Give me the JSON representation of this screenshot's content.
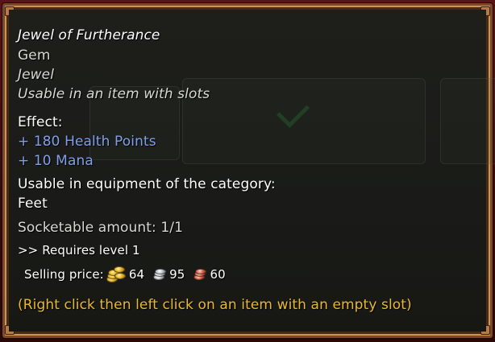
{
  "tooltip": {
    "item_name": "Jewel of Furtherance",
    "item_class": "Gem",
    "item_type": "Jewel",
    "usage": "Usable in an item with slots",
    "effect_header": "Effect:",
    "effects": [
      "+ 180 Health Points",
      "+ 10 Mana"
    ],
    "category_header": "Usable in equipment of the category:",
    "category": "Feet",
    "socketable": "Socketable amount: 1/1",
    "requirement": ">> Requires level 1",
    "selling_label": "Selling price:",
    "price": {
      "gold": "64",
      "silver": "95",
      "copper": "60"
    },
    "hint": "(Right click then left click on an item with an empty slot)"
  },
  "icons": {
    "gold": "gold-coins-icon",
    "silver": "silver-coins-icon",
    "copper": "copper-coins-icon"
  },
  "colors": {
    "effect_text": "#7fa0e8",
    "hint_text": "#e9b92a",
    "frame_border": "#c99655",
    "background": "#3a0a0c"
  }
}
